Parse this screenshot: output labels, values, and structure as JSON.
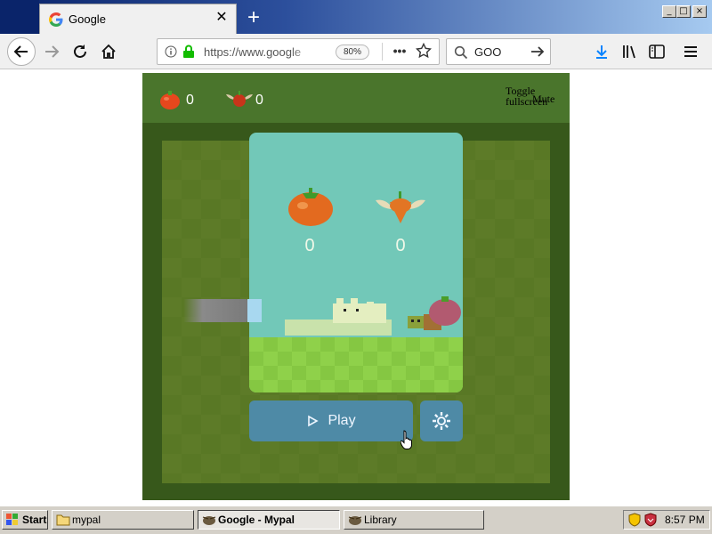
{
  "browser": {
    "tab": {
      "title": "Google",
      "favicon": "google-g-icon"
    },
    "window_controls": {
      "minimize": "_",
      "maximize": "□",
      "close": "×"
    },
    "url": "https://www.google",
    "zoom": "80%",
    "page_actions": "•••",
    "search_value": "GOO"
  },
  "game": {
    "header": {
      "apple_count": "0",
      "trophy_count": "0",
      "toggle_fullscreen": "Toggle fullscreen",
      "mute": "Mute"
    },
    "start_card": {
      "apple_score": "0",
      "trophy_score": "0"
    },
    "play_label": "Play",
    "colors": {
      "grass_light": "#aad751",
      "grass_dark": "#a2d149",
      "header": "#4a752c",
      "button": "#4e8aa6",
      "card": "#72c8b8"
    }
  },
  "taskbar": {
    "start": "Start",
    "tasks": [
      "mypal",
      "Google - Mypal",
      "Library"
    ],
    "clock": "8:57 PM"
  }
}
